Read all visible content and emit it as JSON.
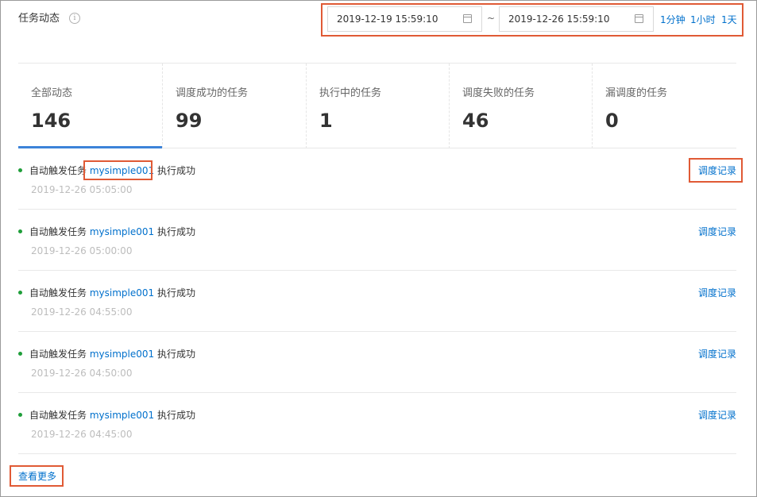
{
  "header": {
    "title": "任务动态",
    "info_icon": "info-circle-icon",
    "start_date": "2019-12-19 15:59:10",
    "end_date": "2019-12-26 15:59:10",
    "separator": "~",
    "quick_ranges": [
      "1分钟",
      "1小时",
      "1天"
    ]
  },
  "stats": [
    {
      "label": "全部动态",
      "value": "146",
      "active": true
    },
    {
      "label": "调度成功的任务",
      "value": "99"
    },
    {
      "label": "执行中的任务",
      "value": "1"
    },
    {
      "label": "调度失败的任务",
      "value": "46"
    },
    {
      "label": "漏调度的任务",
      "value": "0"
    }
  ],
  "activities": [
    {
      "prefix": "自动触发任务",
      "task": "mysimple001",
      "suffix": "执行成功",
      "time": "2019-12-26 05:05:00",
      "action": "调度记录"
    },
    {
      "prefix": "自动触发任务",
      "task": "mysimple001",
      "suffix": "执行成功",
      "time": "2019-12-26 05:00:00",
      "action": "调度记录"
    },
    {
      "prefix": "自动触发任务",
      "task": "mysimple001",
      "suffix": "执行成功",
      "time": "2019-12-26 04:55:00",
      "action": "调度记录"
    },
    {
      "prefix": "自动触发任务",
      "task": "mysimple001",
      "suffix": "执行成功",
      "time": "2019-12-26 04:50:00",
      "action": "调度记录"
    },
    {
      "prefix": "自动触发任务",
      "task": "mysimple001",
      "suffix": "执行成功",
      "time": "2019-12-26 04:45:00",
      "action": "调度记录"
    }
  ],
  "footer": {
    "more_label": "查看更多"
  },
  "colors": {
    "accent": "#0070cc",
    "highlight": "#e05a35",
    "success": "#1f9e3a",
    "active_tab": "#3c83d9"
  }
}
